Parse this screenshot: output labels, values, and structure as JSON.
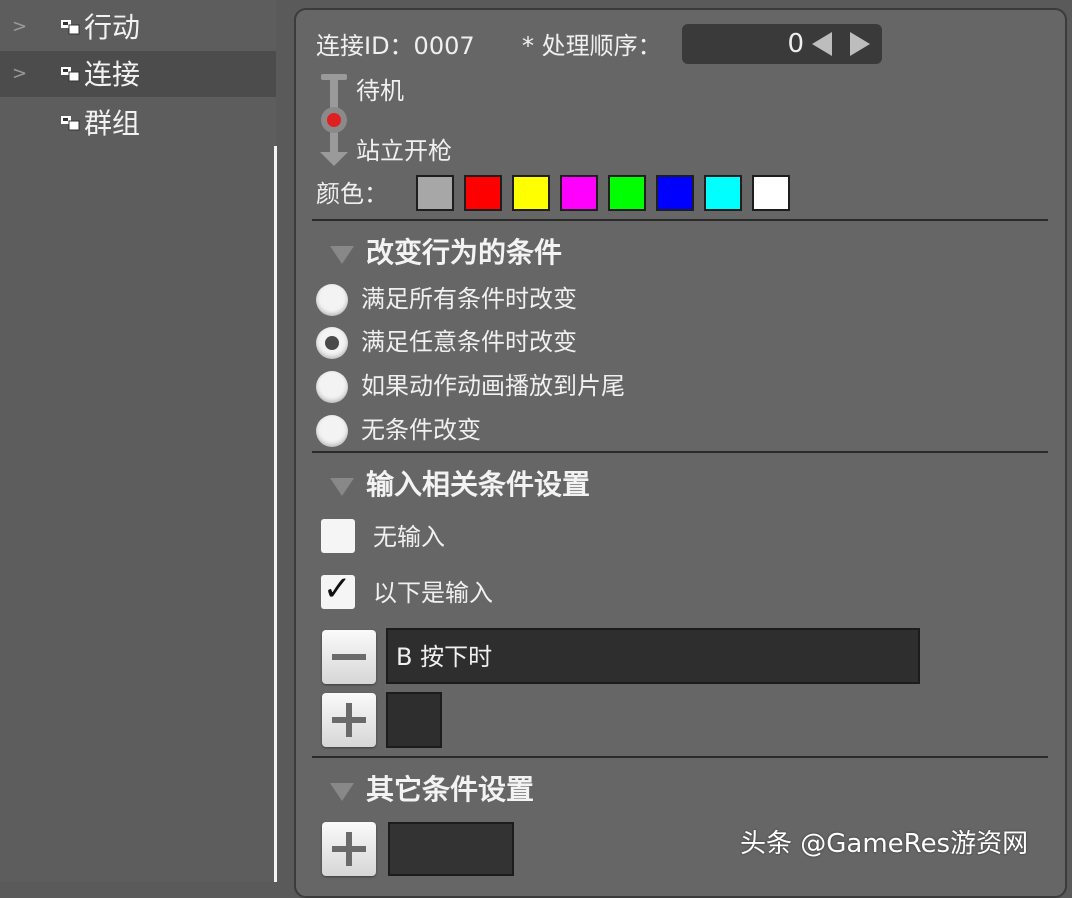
{
  "tree": {
    "items": [
      {
        "label": "行动"
      },
      {
        "label": "连接"
      },
      {
        "label": "群组"
      }
    ]
  },
  "connection": {
    "id_label": "连接ID：0007",
    "order_label": "* 处理顺序：",
    "order_value": "0"
  },
  "states": {
    "from": "待机",
    "to": "站立开枪"
  },
  "color": {
    "label": "颜色：",
    "swatches": [
      "#a7a7a7",
      "#ff0000",
      "#ffff00",
      "#ff00ff",
      "#00ff00",
      "#0000ff",
      "#00ffff",
      "#ffffff"
    ]
  },
  "conditions": {
    "header": "改变行为的条件",
    "options": [
      {
        "label": "满足所有条件时改变",
        "checked": false
      },
      {
        "label": "满足任意条件时改变",
        "checked": true
      },
      {
        "label": "如果动作动画播放到片尾",
        "checked": false
      },
      {
        "label": "无条件改变",
        "checked": false
      }
    ]
  },
  "input": {
    "header": "输入相关条件设置",
    "no_input": {
      "label": "无输入",
      "checked": false
    },
    "following": {
      "label": "以下是输入",
      "checked": true
    },
    "entry_value": "B 按下时"
  },
  "other": {
    "header": "其它条件设置"
  },
  "watermark": "头条 @GameRes游资网"
}
